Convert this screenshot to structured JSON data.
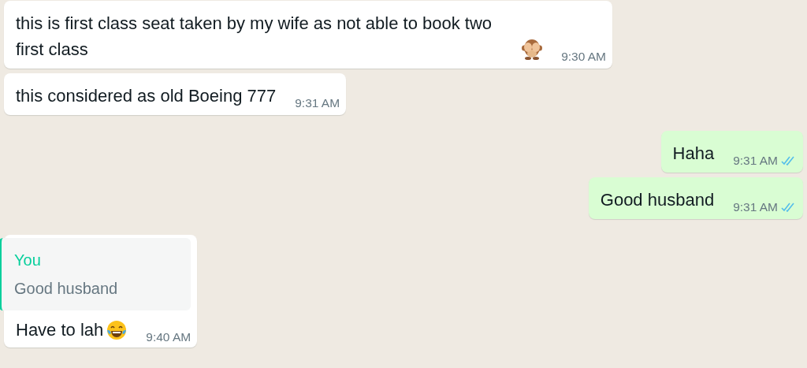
{
  "messages": [
    {
      "outgoing": false,
      "kind": "emoji",
      "text": "this is first class seat taken by my wife as not able to book two first class",
      "time": "9:30 AM"
    },
    {
      "outgoing": false,
      "kind": "plain",
      "text": "this considered as old Boeing 777",
      "time": "9:31 AM"
    },
    {
      "outgoing": true,
      "kind": "plain",
      "text": "Haha",
      "time": "9:31 AM",
      "read": true
    },
    {
      "outgoing": true,
      "kind": "plain",
      "text": "Good husband",
      "time": "9:31 AM",
      "read": true
    },
    {
      "outgoing": false,
      "kind": "emoji",
      "quote": {
        "author": "You",
        "text": "Good husband"
      },
      "text": "Have to lah",
      "time": "9:40 AM"
    }
  ]
}
